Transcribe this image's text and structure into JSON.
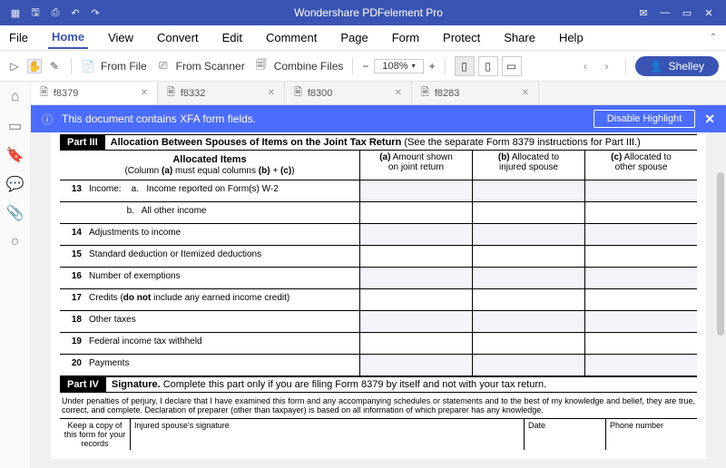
{
  "app": {
    "title": "Wondershare PDFelement Pro"
  },
  "menu": [
    "File",
    "Home",
    "View",
    "Convert",
    "Edit",
    "Comment",
    "Page",
    "Form",
    "Protect",
    "Share",
    "Help"
  ],
  "menu_active": 1,
  "toolbar": {
    "fromfile": "From File",
    "fromscanner": "From Scanner",
    "combine": "Combine Files",
    "zoom": "108%",
    "user": "Shelley"
  },
  "tabs": [
    {
      "label": "f8379",
      "active": true
    },
    {
      "label": "f8332",
      "active": false
    },
    {
      "label": "f8300",
      "active": false
    },
    {
      "label": "f8283",
      "active": false
    }
  ],
  "banner": {
    "msg": "This document contains XFA form fields.",
    "btn": "Disable Highlight"
  },
  "form": {
    "part3_label": "Part III",
    "part3_title": "Allocation Between Spouses of Items on the Joint Tax Return",
    "part3_note": "(See the separate Form 8379 instructions for Part III.)",
    "head_allocated": "Allocated Items",
    "head_colnote_1": "(Column ",
    "head_colnote_a": "(a)",
    "head_colnote_2": " must equal columns ",
    "head_colnote_b": "(b)",
    "head_colnote_3": " + ",
    "head_colnote_c": "(c)",
    "head_colnote_4": ")",
    "col_a": "(a) Amount shown on joint return",
    "col_b": "(b) Allocated to injured spouse",
    "col_c": "(c) Allocated to other spouse",
    "rows": [
      {
        "n": "13",
        "d": "Income:    a.   Income reported on Form(s) W-2"
      },
      {
        "n": "",
        "d": "               b.   All other income"
      },
      {
        "n": "14",
        "d": "Adjustments to income"
      },
      {
        "n": "15",
        "d": "Standard deduction or Itemized deductions"
      },
      {
        "n": "16",
        "d": "Number of exemptions"
      },
      {
        "n": "17",
        "d": "Credits (do not include any earned income credit)"
      },
      {
        "n": "18",
        "d": "Other taxes"
      },
      {
        "n": "19",
        "d": "Federal income tax withheld"
      },
      {
        "n": "20",
        "d": "Payments"
      }
    ],
    "part4_label": "Part IV",
    "part4_title": "Signature.",
    "part4_text": " Complete this part only if you are filing Form 8379 by itself and not with your tax return.",
    "perjury": "Under penalties of perjury, I declare that I have examined this form and any accompanying schedules or statements and to the best of my knowledge and belief, they are true, correct, and complete. Declaration of preparer (other than taxpayer) is based on all information of which preparer has any knowledge.",
    "keep": "Keep a copy of this form for your records",
    "sig_spouse": "Injured spouse's signature",
    "sig_date": "Date",
    "sig_phone": "Phone number"
  }
}
